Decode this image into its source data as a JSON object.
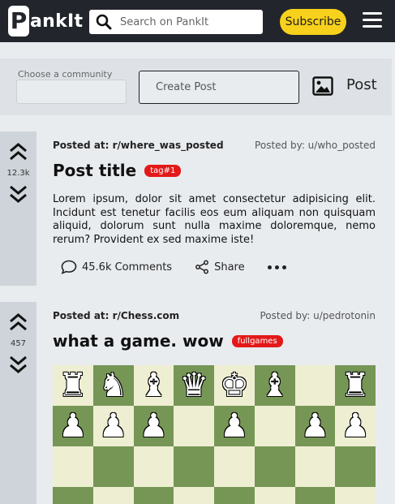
{
  "header": {
    "logo_first": "P",
    "logo_rest": "ankIt",
    "search_placeholder": "Search on PankIt",
    "subscribe_label": "Subscribe"
  },
  "create": {
    "community_label": "Choose a community",
    "create_placeholder": "Create Post",
    "post_label": "Post"
  },
  "posts": [
    {
      "votes": "12.3k",
      "posted_at": "Posted at: r/where_was_posted",
      "posted_by": "Posted by: u/who_posted",
      "title": "Post title",
      "tag": "tag#1",
      "content": "Lorem ipsum, dolor sit amet consectetur adipisicing elit. Incidunt est tenetur facilis eos eum aliquam non quisquam aliquid, dolorum sunt nulla maxime doloremque, nemo rerum? Provident ex sed maxime iste!",
      "comments": "45.6k Comments",
      "share": "Share"
    },
    {
      "votes": "457",
      "posted_at": "Posted at: r/Chess.com",
      "posted_by": "Posted by: u/pedrotonin",
      "title": "what a game. wow",
      "tag": "fullgames"
    }
  ],
  "chess": {
    "rows": [
      [
        "♜",
        "♞",
        "♝",
        "♛",
        "♚",
        "♝",
        "",
        "♜"
      ],
      [
        "♟",
        "♟",
        "♟",
        "",
        "♟",
        "",
        "♟",
        "♟"
      ],
      [
        "",
        "",
        "",
        "",
        "",
        "",
        "",
        ""
      ],
      [
        "",
        "",
        "",
        "",
        "",
        "",
        "",
        ""
      ]
    ]
  },
  "colors": {
    "header_bg": "#22252b",
    "accent_yellow": "#f7d11c",
    "tag_red": "#e31919",
    "board_light": "#eeeed2",
    "board_dark": "#769656"
  }
}
